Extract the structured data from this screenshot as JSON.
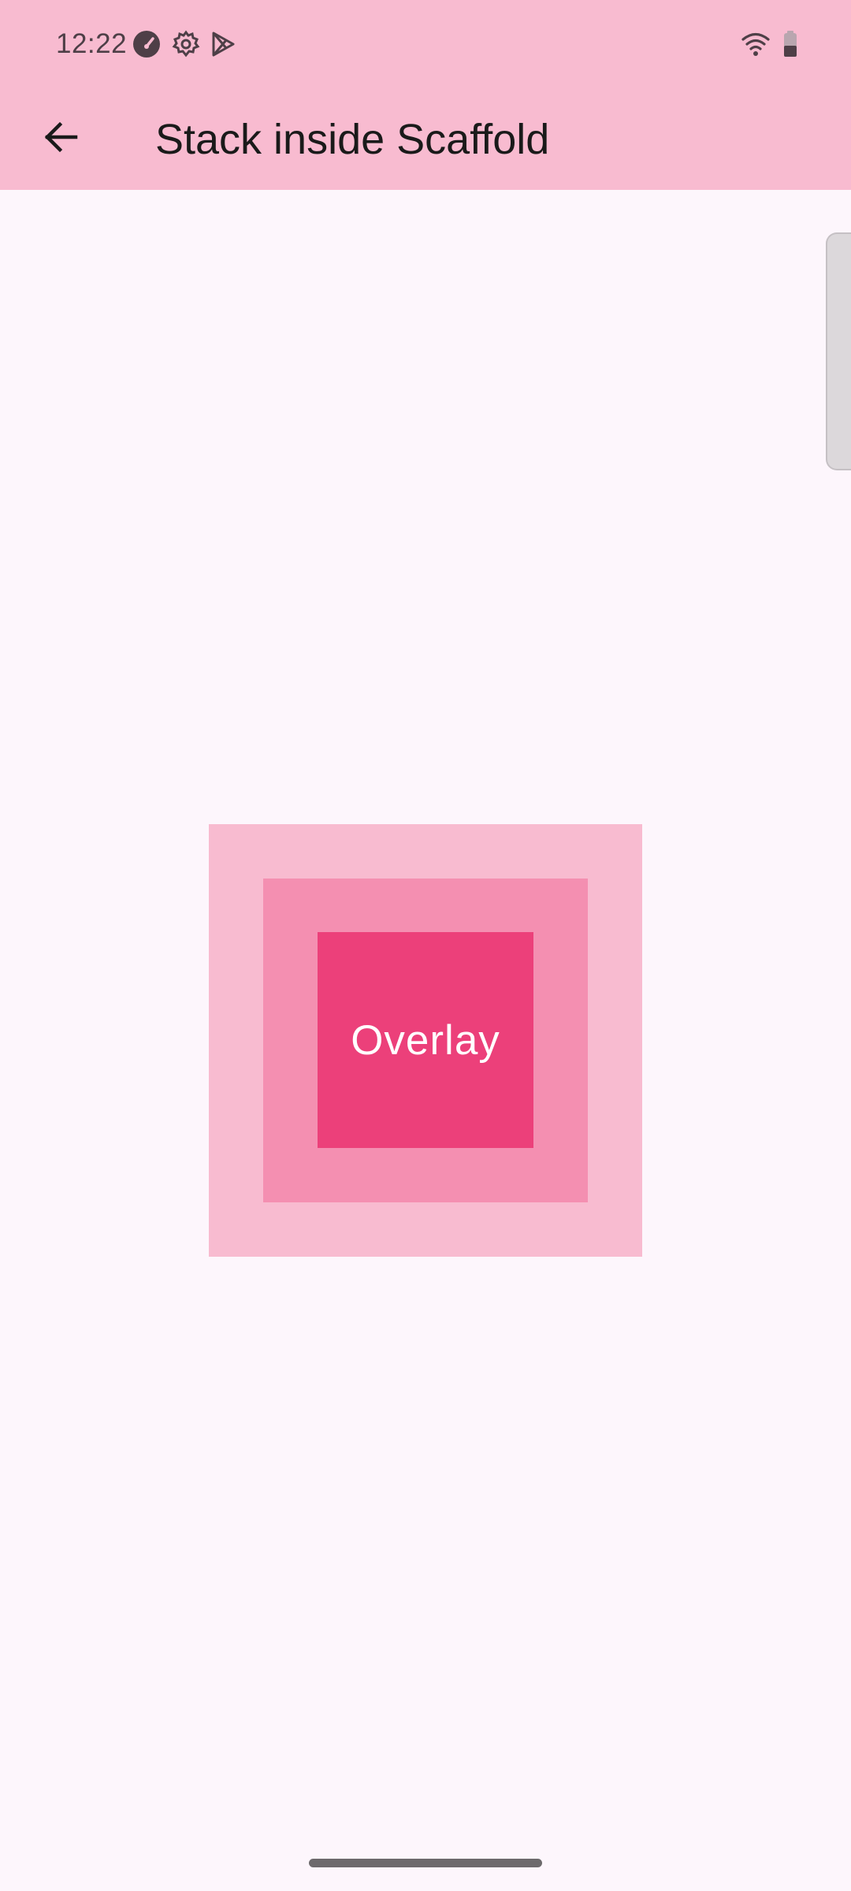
{
  "status_bar": {
    "time": "12:22",
    "left_icons": [
      "speedometer-icon",
      "settings-gear-icon",
      "play-store-icon"
    ],
    "right_icons": [
      "wifi-icon",
      "battery-icon"
    ]
  },
  "toolbar": {
    "back_icon": "arrow-back-icon",
    "title": "Stack inside Scaffold"
  },
  "stack": {
    "overlay_label": "Overlay",
    "colors": {
      "outer": "#F8BBD0",
      "middle": "#F48FB1",
      "inner": "#EC407A"
    }
  },
  "colors": {
    "app_bar": "#F8BBD0",
    "background": "#FDF6FC"
  }
}
